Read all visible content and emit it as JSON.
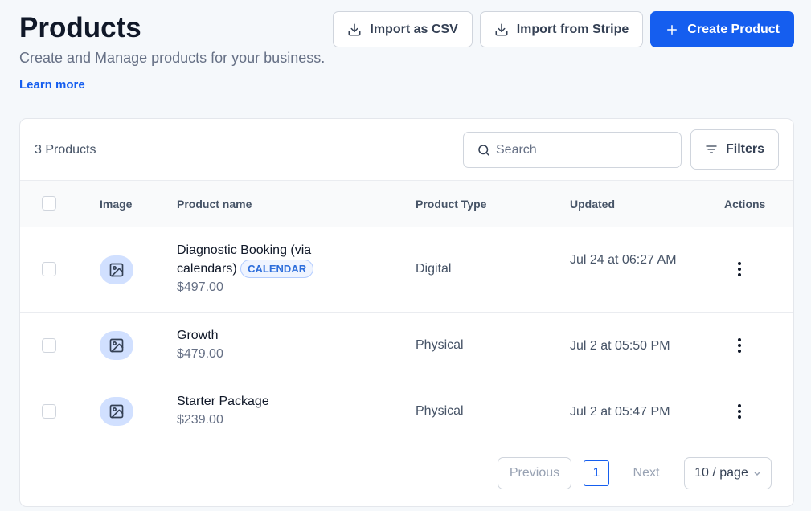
{
  "header": {
    "title": "Products",
    "subtitle": "Create and Manage products for your business.",
    "learn_more": "Learn more"
  },
  "actions": {
    "import_csv": "Import as CSV",
    "import_stripe": "Import from Stripe",
    "create_product": "Create Product"
  },
  "toolbar": {
    "count": "3 Products",
    "search_placeholder": "Search",
    "filters": "Filters"
  },
  "table": {
    "columns": [
      "Image",
      "Product name",
      "Product Type",
      "Updated",
      "Actions"
    ],
    "rows": [
      {
        "name": "Diagnostic Booking (via calendars)",
        "name_line1": "Diagnostic Booking (via",
        "name_line2": "calendars)",
        "badge": "CALENDAR",
        "price": "$497.00",
        "type": "Digital",
        "updated": "Jul 24 at 06:27 AM"
      },
      {
        "name": "Growth",
        "price": "$479.00",
        "type": "Physical",
        "updated": "Jul 2 at 05:50 PM"
      },
      {
        "name": "Starter Package",
        "price": "$239.00",
        "type": "Physical",
        "updated": "Jul 2 at 05:47 PM"
      }
    ]
  },
  "pagination": {
    "previous": "Previous",
    "current_page": "1",
    "next": "Next",
    "per_page": "10 / page"
  },
  "colors": {
    "primary": "#155eef",
    "background": "#f5f8fb",
    "thumb": "#d1e0ff"
  }
}
